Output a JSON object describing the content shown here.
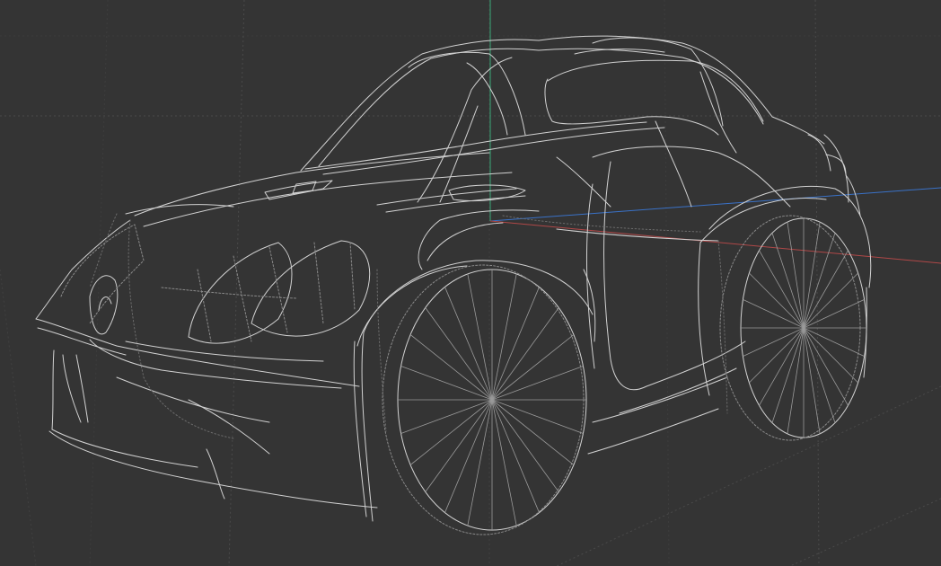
{
  "viewport": {
    "mode": "wireframe",
    "background_color": "#343434",
    "grid_color": "#4a4a4a",
    "wire_color": "#d2d2d2"
  },
  "axes": {
    "x_axis_color": "#b04848",
    "y_axis_color": "#3aa878",
    "z_axis_color": "#3a72c8"
  },
  "model": {
    "object_type": "car",
    "render_style": "wireframe"
  }
}
